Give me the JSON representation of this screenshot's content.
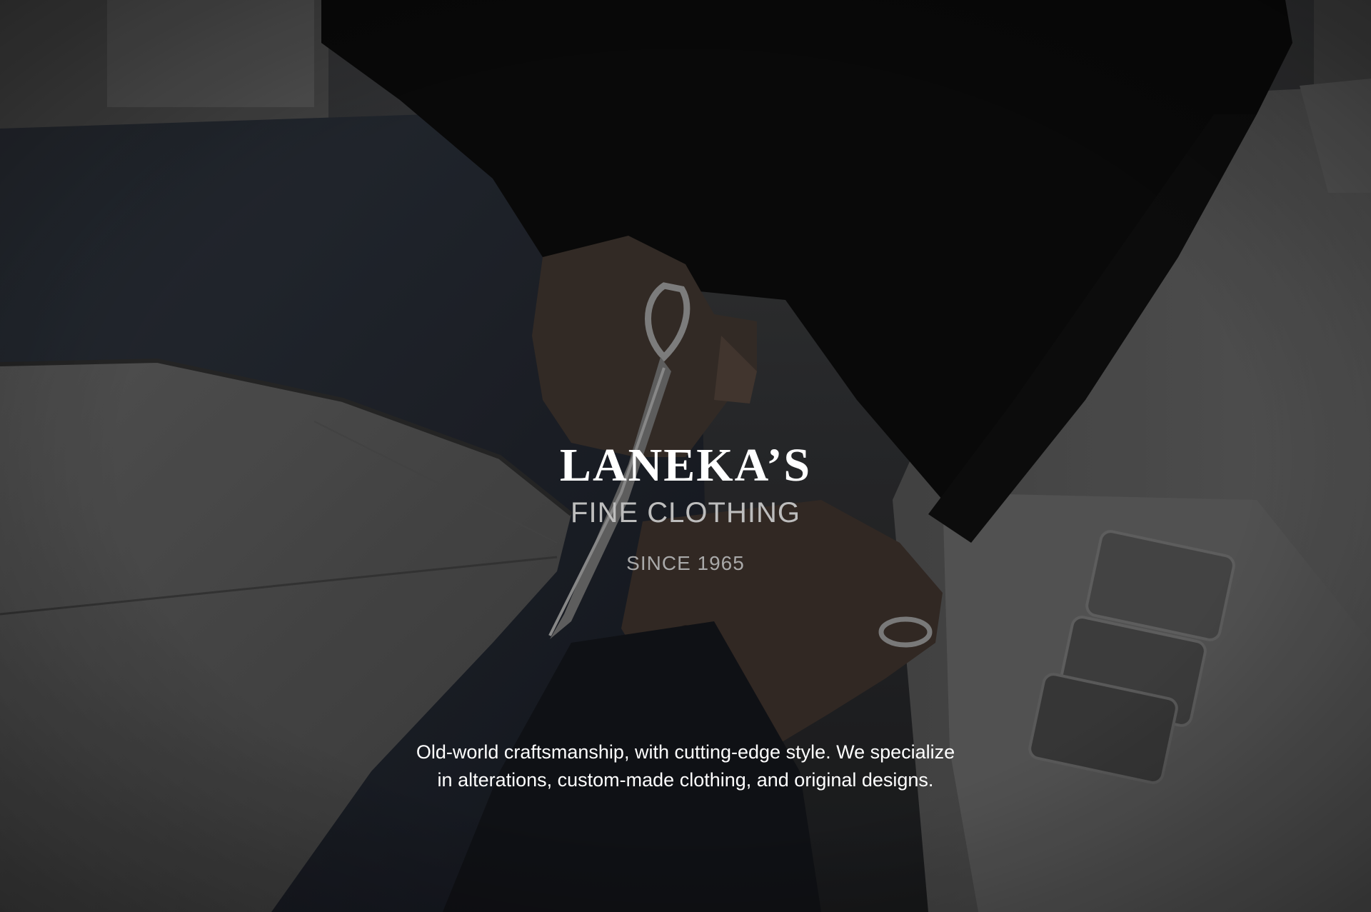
{
  "hero": {
    "title": "LANEKA’S",
    "subtitle": "FINE CLOTHING",
    "since": "SINCE 1965",
    "tagline_line1": "Old-world craftsmanship, with cutting-edge style. We specialize",
    "tagline_line2": "in alterations, custom-made clothing, and original designs."
  },
  "colors": {
    "title": "#ffffff",
    "subtitle": "#bdbdbd",
    "since": "#a9a9a9",
    "tagline": "#ffffff"
  }
}
